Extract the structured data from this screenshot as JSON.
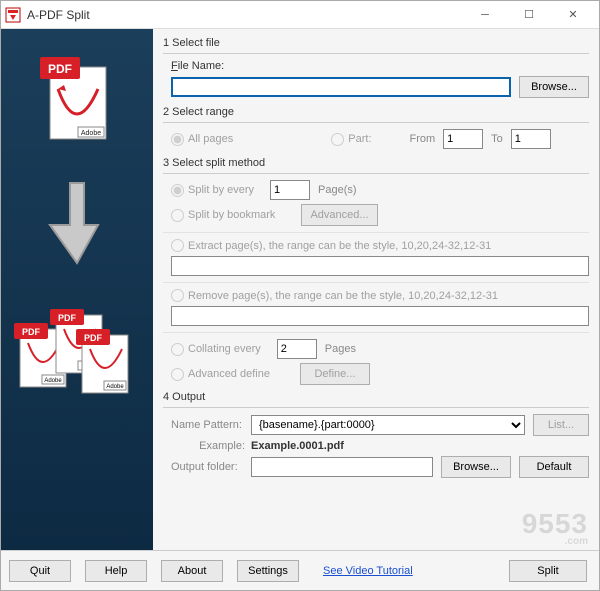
{
  "title": "A-PDF Split",
  "section1": {
    "title": "1 Select file",
    "file_label_prefix": "F",
    "file_label_rest": "ile Name:",
    "browse": "Browse..."
  },
  "section2": {
    "title": "2 Select range",
    "all_pages": "All pages",
    "part": "Part:",
    "from": "From",
    "to": "To",
    "from_val": "1",
    "to_val": "1"
  },
  "section3": {
    "title": "3 Select split method",
    "split_every": "Split by every",
    "split_every_val": "1",
    "pages_suffix": "Page(s)",
    "split_bookmark": "Split by bookmark",
    "advanced": "Advanced...",
    "extract": "Extract page(s), the range can be the style, 10,20,24-32,12-31",
    "remove": "Remove page(s), the range can be the style, 10,20,24-32,12-31",
    "collating": "Collating every",
    "collating_val": "2",
    "collating_suffix": "Pages",
    "adv_define": "Advanced define",
    "define": "Define..."
  },
  "section4": {
    "title": "4 Output",
    "name_pattern_label": "Name Pattern:",
    "name_pattern_val": "{basename}.{part:0000}",
    "list": "List...",
    "example_label": "Example:",
    "example_val": "Example.0001.pdf",
    "output_folder_label": "Output folder:",
    "browse": "Browse...",
    "default": "Default"
  },
  "footer": {
    "quit": "Quit",
    "help": "Help",
    "about": "About",
    "settings": "Settings",
    "tutorial": "See Video Tutorial",
    "split": "Split"
  },
  "watermark": {
    "main": "9553",
    "sub": ".com"
  }
}
